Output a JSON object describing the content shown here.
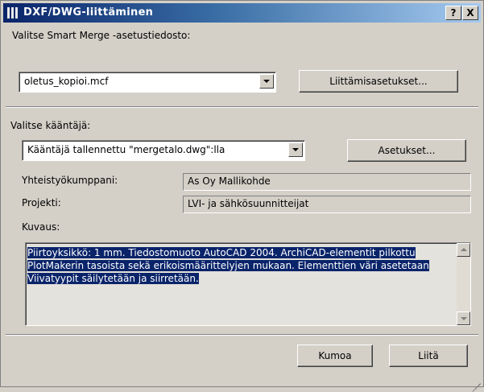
{
  "window": {
    "title": "DXF/DWG-liittäminen",
    "help_label": "?",
    "close_label": "X"
  },
  "merge": {
    "label": "Valitse Smart Merge -asetustiedosto:",
    "file_value": "oletus_kopioi.mcf",
    "settings_button": "Liittämisasetukset..."
  },
  "translator": {
    "label": "Valitse kääntäjä:",
    "value": "Kääntäjä tallennettu \"mergetalo.dwg\":lla",
    "settings_button": "Asetukset..."
  },
  "info": {
    "partner_label": "Yhteistyökumppani:",
    "partner_value": "As Oy Mallikohde",
    "project_label": "Projekti:",
    "project_value": "LVI- ja sähkösuunnitteijat"
  },
  "description": {
    "label": "Kuvaus:",
    "lines": [
      "Piirtoyksikkö: 1 mm. Tiedostomuoto AutoCAD 2004. ArchiCAD-elementit pilkottu",
      "PlotMakerin tasoista sekä erikoismäärittelyjen mukaan. Elementtien väri asetetaan",
      "Viivatyypit säilytetään ja siirretään."
    ]
  },
  "footer": {
    "cancel_button": "Kumoa",
    "ok_button": "Liitä"
  }
}
